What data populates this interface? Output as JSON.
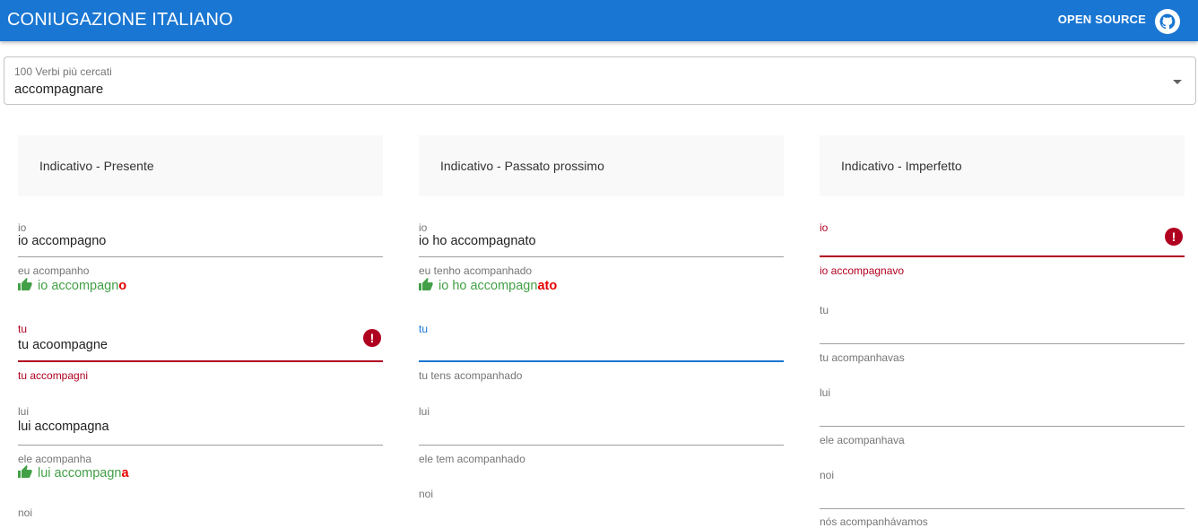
{
  "app": {
    "title": "CONIUGAZIONE ITALIANO",
    "open_source_label": "OPEN SOURCE"
  },
  "verb_select": {
    "label": "100 Verbi più cercati",
    "value": "accompagnare"
  },
  "columns": [
    {
      "title": "Indicativo - Presente",
      "fields": [
        {
          "label": "io",
          "value": "io accompagno",
          "helper": "eu acompanho",
          "feedback_prefix": "io accompagn",
          "feedback_suffix": "o"
        },
        {
          "label": "tu",
          "value": "tu acoompagne",
          "helper": "tu accompagni",
          "error": true
        },
        {
          "label": "lui",
          "value": "lui accompagna",
          "helper": "ele acompanha",
          "feedback_prefix": "lui accompagn",
          "feedback_suffix": "a"
        },
        {
          "label": "noi"
        }
      ]
    },
    {
      "title": "Indicativo - Passato prossimo",
      "fields": [
        {
          "label": "io",
          "value": "io ho accompagnato",
          "helper": "eu tenho acompanhado",
          "feedback_prefix": "io ho accompagn",
          "feedback_suffix": "ato"
        },
        {
          "label": "tu",
          "value": "",
          "helper": "tu tens acompanhado",
          "focused": true
        },
        {
          "label": "lui",
          "value": "",
          "helper": "ele tem acompanhado"
        },
        {
          "label": "noi"
        }
      ]
    },
    {
      "title": "Indicativo - Imperfetto",
      "fields": [
        {
          "label": "io",
          "value": "",
          "helper": "io accompagnavo",
          "error": true
        },
        {
          "label": "tu",
          "value": "",
          "helper": "tu acompanhavas"
        },
        {
          "label": "lui",
          "value": "",
          "helper": "ele acompanhava"
        },
        {
          "label": "noi",
          "value": "",
          "helper": "nós acompanhávamos"
        }
      ]
    }
  ],
  "colors": {
    "appbar": "#1976d2",
    "error": "#b00020",
    "success": "#43a047",
    "focus": "#1976d2"
  },
  "icons": {
    "github": "github-icon",
    "dropdown": "arrow-drop-down-icon",
    "error": "error-icon",
    "correct": "thumb-up-icon"
  }
}
